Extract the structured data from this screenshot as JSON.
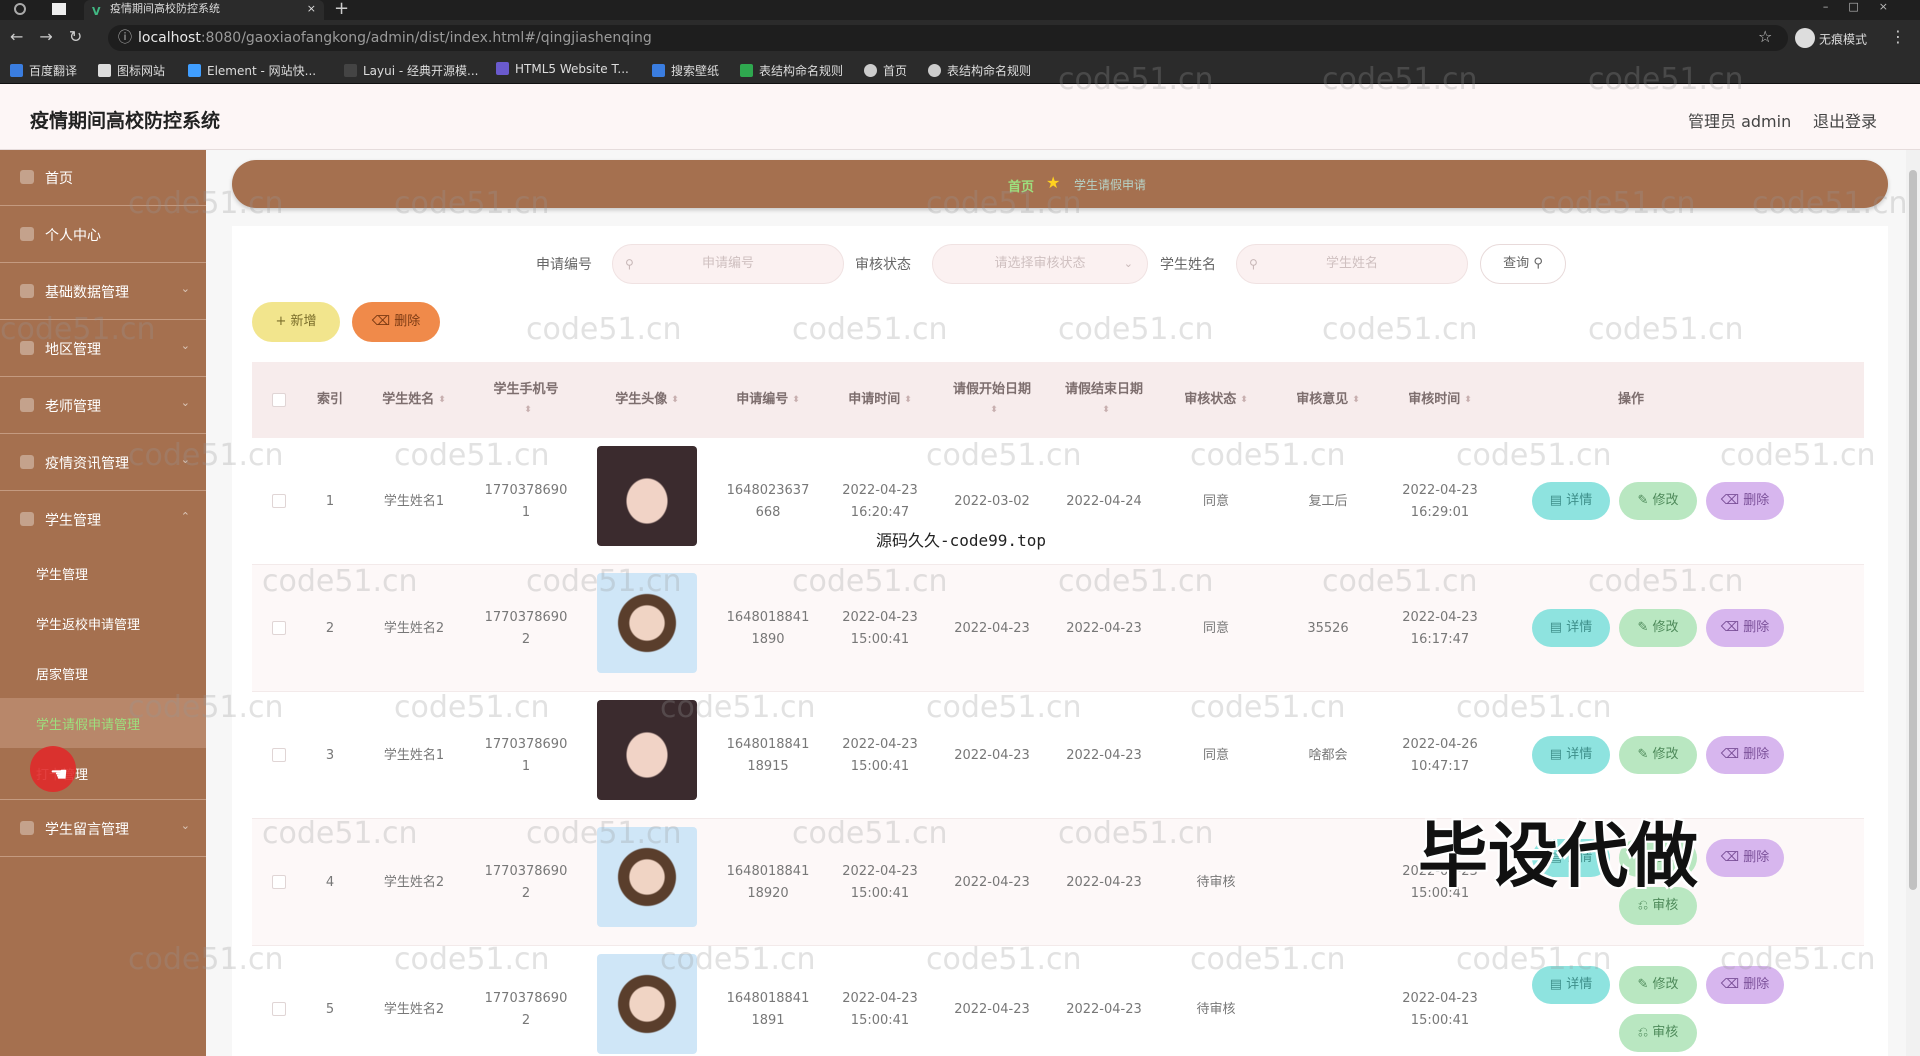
{
  "browser": {
    "tab_title": "疫情期间高校防控系统",
    "url_host": "localhost",
    "url_rest": ":8080/gaoxiaofangkong/admin/dist/index.html#/qingjiashenqing",
    "incognito": "无痕模式",
    "bookmarks": [
      "百度翻译",
      "图标网站",
      "Element - 网站快...",
      "Layui - 经典开源模...",
      "HTML5 Website T...",
      "搜索壁纸",
      "表结构命名规则",
      "首页",
      "表结构命名规则"
    ]
  },
  "header": {
    "title": "疫情期间高校防控系统",
    "user": "管理员 admin",
    "logout": "退出登录"
  },
  "sidebar": {
    "items": [
      "首页",
      "个人中心",
      "基础数据管理",
      "地区管理",
      "老师管理",
      "疫情资讯管理",
      "学生管理"
    ],
    "sub_items": [
      "学生管理",
      "学生返校申请管理",
      "居家管理",
      "学生请假申请管理",
      "打卡管理"
    ],
    "last_item": "学生留言管理"
  },
  "breadcrumb": {
    "home": "首页",
    "current": "学生请假申请"
  },
  "search": {
    "label_no": "申请编号",
    "placeholder_no": "申请编号",
    "label_status": "审核状态",
    "placeholder_status": "请选择审核状态",
    "label_name": "学生姓名",
    "placeholder_name": "学生姓名",
    "query": "查询"
  },
  "actions": {
    "add": "新增",
    "delete": "删除"
  },
  "table": {
    "headers": [
      "索引",
      "学生姓名",
      "学生手机号",
      "学生头像",
      "申请编号",
      "申请时间",
      "请假开始日期",
      "请假结束日期",
      "审核状态",
      "审核意见",
      "审核时间",
      "操作"
    ],
    "ops": {
      "detail": "详情",
      "edit": "修改",
      "remove": "删除",
      "audit": "审核"
    },
    "rows": [
      {
        "idx": "1",
        "name": "学生姓名1",
        "phone1": "1770378690",
        "phone2": "1",
        "no1": "1648023637",
        "no2": "668",
        "time1": "2022-04-23",
        "time2": "16:20:47",
        "start": "2022-03-02",
        "end": "2022-04-24",
        "status": "同意",
        "opinion": "复工后",
        "atime1": "2022-04-23",
        "atime2": "16:29:01"
      },
      {
        "idx": "2",
        "name": "学生姓名2",
        "phone1": "1770378690",
        "phone2": "2",
        "no1": "1648018841",
        "no2": "1890",
        "time1": "2022-04-23",
        "time2": "15:00:41",
        "start": "2022-04-23",
        "end": "2022-04-23",
        "status": "同意",
        "opinion": "35526",
        "atime1": "2022-04-23",
        "atime2": "16:17:47"
      },
      {
        "idx": "3",
        "name": "学生姓名1",
        "phone1": "1770378690",
        "phone2": "1",
        "no1": "1648018841",
        "no2": "18915",
        "time1": "2022-04-23",
        "time2": "15:00:41",
        "start": "2022-04-23",
        "end": "2022-04-23",
        "status": "同意",
        "opinion": "啥都会",
        "atime1": "2022-04-26",
        "atime2": "10:47:17"
      },
      {
        "idx": "4",
        "name": "学生姓名2",
        "phone1": "1770378690",
        "phone2": "2",
        "no1": "1648018841",
        "no2": "18920",
        "time1": "2022-04-23",
        "time2": "15:00:41",
        "start": "2022-04-23",
        "end": "2022-04-23",
        "status": "待审核",
        "opinion": "",
        "atime1": "2022-04-23",
        "atime2": "15:00:41"
      },
      {
        "idx": "5",
        "name": "学生姓名2",
        "phone1": "1770378690",
        "phone2": "2",
        "no1": "1648018841",
        "no2": "1891",
        "time1": "2022-04-23",
        "time2": "15:00:41",
        "start": "2022-04-23",
        "end": "2022-04-23",
        "status": "待审核",
        "opinion": "",
        "atime1": "2022-04-23",
        "atime2": "15:00:41"
      }
    ]
  },
  "overlays": {
    "watermark": "code51.cn",
    "small": "源码久久-code99.top",
    "big": "毕设代做"
  },
  "colors": {
    "sidebar": "#a5704f",
    "accent_green": "#9de07e",
    "detail": "#8ee3df",
    "edit": "#b9e7c1",
    "remove": "#d7b6ee"
  }
}
